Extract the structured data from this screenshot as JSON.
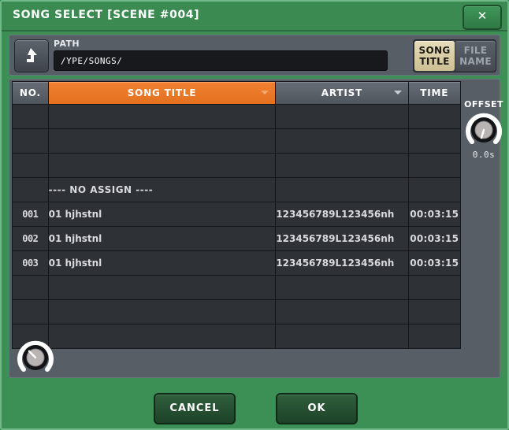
{
  "window": {
    "title": "SONG SELECT [SCENE #004]",
    "close_label": "✕"
  },
  "path_bar": {
    "label": "PATH",
    "value": "/YPE/SONGS/",
    "up_icon": "up-level-arrow-icon"
  },
  "sort_mode": {
    "song_title_line1": "SONG",
    "song_title_line2": "TITLE",
    "file_name_line1": "FILE",
    "file_name_line2": "NAME",
    "selected": "SONG TITLE"
  },
  "table": {
    "columns": [
      {
        "key": "no",
        "label": "NO.",
        "sortable": false,
        "active": false
      },
      {
        "key": "title",
        "label": "SONG TITLE",
        "sortable": true,
        "active": true
      },
      {
        "key": "artist",
        "label": "ARTIST",
        "sortable": true,
        "active": false
      },
      {
        "key": "time",
        "label": "TIME",
        "sortable": false,
        "active": false
      }
    ],
    "rows": [
      {
        "no": "",
        "title": "",
        "artist": "",
        "time": "",
        "kind": "empty"
      },
      {
        "no": "",
        "title": "",
        "artist": "",
        "time": "",
        "kind": "empty"
      },
      {
        "no": "",
        "title": "",
        "artist": "",
        "time": "",
        "kind": "empty"
      },
      {
        "no": "",
        "title": "---- NO ASSIGN ----",
        "artist": "",
        "time": "",
        "kind": "noassign"
      },
      {
        "no": "001",
        "title": "01 hjhstnl",
        "artist": "123456789L123456nh",
        "time": "00:03:15",
        "kind": "selected"
      },
      {
        "no": "002",
        "title": "01 hjhstnl",
        "artist": "123456789L123456nh",
        "time": "00:03:15",
        "kind": "normal"
      },
      {
        "no": "003",
        "title": "01 hjhstnl",
        "artist": "123456789L123456nh",
        "time": "00:03:15",
        "kind": "normal"
      },
      {
        "no": "",
        "title": "",
        "artist": "",
        "time": "",
        "kind": "empty"
      },
      {
        "no": "",
        "title": "",
        "artist": "",
        "time": "",
        "kind": "empty"
      },
      {
        "no": "",
        "title": "",
        "artist": "",
        "time": "",
        "kind": "empty"
      }
    ]
  },
  "offset": {
    "label": "OFFSET",
    "value": "0.0s"
  },
  "footer": {
    "cancel_label": "CANCEL",
    "ok_label": "OK"
  },
  "colors": {
    "window_green": "#3c8f55",
    "panel_gray": "#585e66",
    "row_dark": "#2e3136",
    "accent_orange": "#e2701f",
    "selected_row": "#ded9de",
    "selected_tab": "#cdbf93"
  }
}
